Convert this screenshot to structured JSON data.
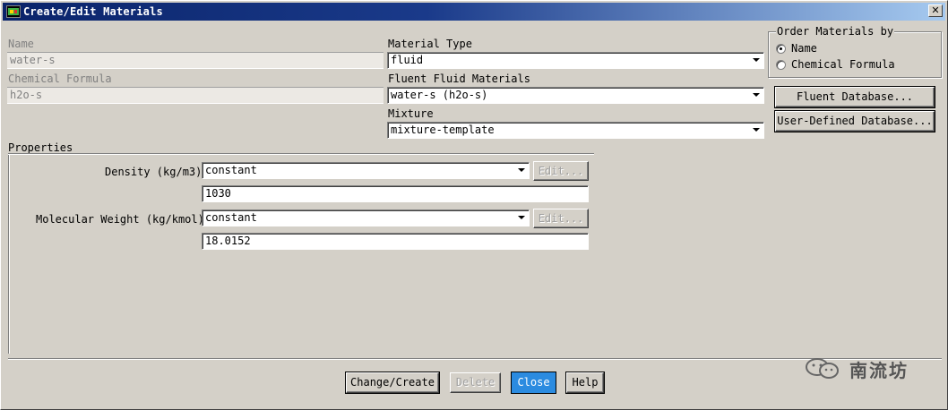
{
  "window": {
    "title": "Create/Edit Materials",
    "close_glyph": "✕",
    "icon": "fluent-app-icon"
  },
  "material": {
    "name_label": "Name",
    "name_value": "water-s",
    "formula_label": "Chemical Formula",
    "formula_value": "h2o-s",
    "type_label": "Material Type",
    "type_value": "fluid",
    "fluent_materials_label": "Fluent Fluid Materials",
    "fluent_materials_value": "water-s (h2o-s)",
    "mixture_label": "Mixture",
    "mixture_value": "mixture-template"
  },
  "order_by": {
    "legend": "Order Materials by",
    "options": [
      {
        "label": "Name",
        "selected": true
      },
      {
        "label": "Chemical Formula",
        "selected": false
      }
    ]
  },
  "database_buttons": {
    "fluent": "Fluent Database...",
    "user_defined": "User-Defined Database..."
  },
  "properties": {
    "section_label": "Properties",
    "rows": [
      {
        "label": "Density (kg/m3)",
        "method": "constant",
        "edit": "Edit...",
        "value": "1030"
      },
      {
        "label": "Molecular Weight (kg/kmol)",
        "method": "constant",
        "edit": "Edit...",
        "value": "18.0152"
      }
    ]
  },
  "footer": {
    "change_create": "Change/Create",
    "delete": "Delete",
    "close": "Close",
    "help": "Help"
  },
  "watermark": {
    "text": "南流坊",
    "icon": "wechat-icon"
  }
}
